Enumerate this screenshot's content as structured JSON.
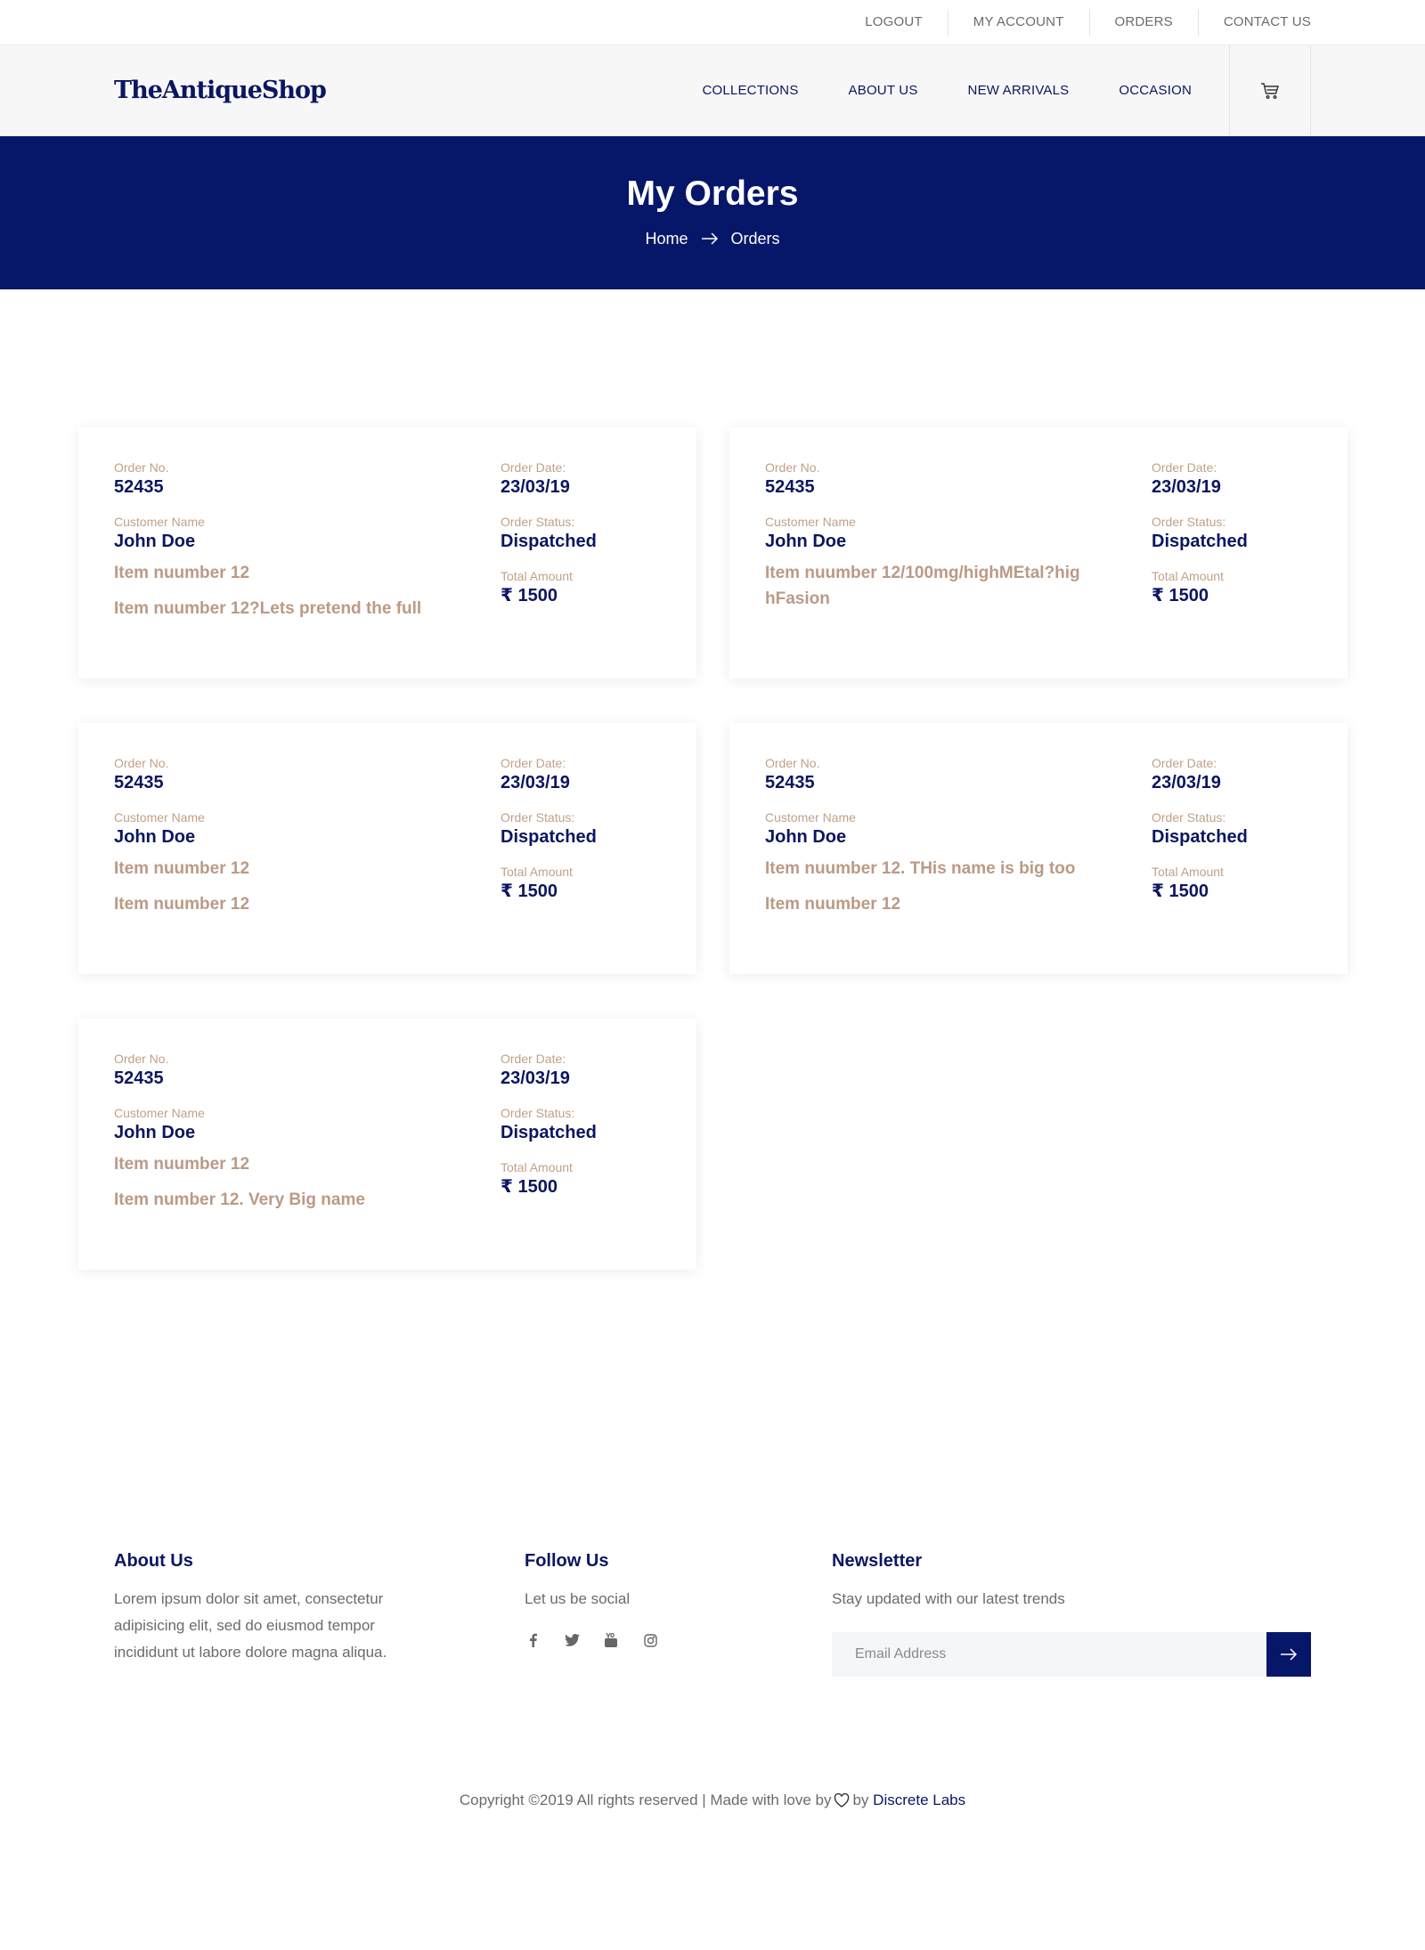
{
  "topbar": {
    "links": [
      "LOGOUT",
      "MY ACCOUNT",
      "ORDERS",
      "CONTACT US"
    ]
  },
  "header": {
    "logo": "TheAntiqueShop",
    "nav": [
      "COLLECTIONS",
      "ABOUT US",
      "NEW ARRIVALS",
      "OCCASION"
    ],
    "cart_icon": "cart-icon"
  },
  "hero": {
    "title": "My Orders",
    "breadcrumb": [
      "Home",
      "Orders"
    ]
  },
  "labels": {
    "order_no": "Order No.",
    "customer_name": "Customer Name",
    "order_date": "Order Date:",
    "order_status": "Order Status:",
    "total_amount": "Total Amount"
  },
  "orders": [
    {
      "order_no": "52435",
      "customer": "John Doe",
      "date": "23/03/19",
      "status": "Dispatched",
      "amount": "₹ 1500",
      "items": [
        "Item nuumber 12",
        "Item nuumber 12?Lets pretend the full"
      ]
    },
    {
      "order_no": "52435",
      "customer": "John Doe",
      "date": "23/03/19",
      "status": "Dispatched",
      "amount": "₹ 1500",
      "items": [
        "Item nuumber 12/100mg/highMEtal?highFasion"
      ]
    },
    {
      "order_no": "52435",
      "customer": "John Doe",
      "date": "23/03/19",
      "status": "Dispatched",
      "amount": "₹ 1500",
      "items": [
        "Item nuumber 12",
        "Item nuumber 12"
      ]
    },
    {
      "order_no": "52435",
      "customer": "John Doe",
      "date": "23/03/19",
      "status": "Dispatched",
      "amount": "₹ 1500",
      "items": [
        "Item nuumber 12. THis name is big too",
        "Item nuumber 12"
      ]
    },
    {
      "order_no": "52435",
      "customer": "John Doe",
      "date": "23/03/19",
      "status": "Dispatched",
      "amount": "₹ 1500",
      "items": [
        "Item nuumber 12",
        "Item number 12. Very Big name"
      ]
    }
  ],
  "footer": {
    "about": {
      "title": "About Us",
      "text": "Lorem ipsum dolor sit amet, consectetur adipisicing elit, sed do eiusmod tempor incididunt ut labore dolore magna aliqua."
    },
    "follow": {
      "title": "Follow Us",
      "text": "Let us be social",
      "icons": [
        "facebook-icon",
        "twitter-icon",
        "youtube-icon",
        "instagram-icon"
      ]
    },
    "newsletter": {
      "title": "Newsletter",
      "text": "Stay updated with our latest trends",
      "placeholder": "Email Address"
    }
  },
  "copyright": {
    "text": "Copyright ©2019 All rights reserved | Made with love by",
    "by": "by",
    "brand": "Discrete Labs"
  }
}
